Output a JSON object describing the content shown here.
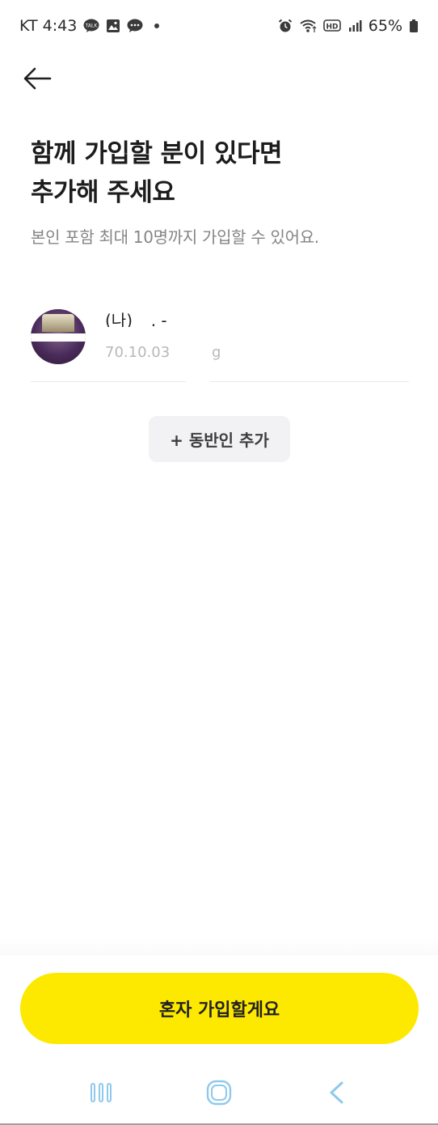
{
  "status_bar": {
    "carrier_time": "KT 4:43",
    "battery": "65%",
    "left_icons": [
      "talk-icon",
      "gallery-icon",
      "message-icon",
      "dot-icon"
    ],
    "right_icons": [
      "alarm-icon",
      "wifi-icon",
      "hd-icon",
      "signal-icon",
      "battery-icon"
    ]
  },
  "header": {
    "back_icon": "back-arrow-icon"
  },
  "main": {
    "title_line1": "함께 가입할 분이 있다면",
    "title_line2": "추가해 주세요",
    "subtitle": "본인 포함 최대 10명까지 가입할 수 있어요.",
    "member": {
      "name": "(나) _  . -",
      "birth": "70.10.03",
      "gender": "g"
    },
    "add_companion_label": "+ 동반인 추가"
  },
  "footer": {
    "join_alone_label": "혼자 가입할게요"
  },
  "nav_bar": {
    "items": [
      "recent-apps-icon",
      "home-icon",
      "back-icon"
    ]
  },
  "colors": {
    "accent": "#fde900",
    "secondary_button_bg": "#f2f2f4",
    "subtitle_text": "#858585",
    "nav_icon": "#8fc9ec"
  }
}
